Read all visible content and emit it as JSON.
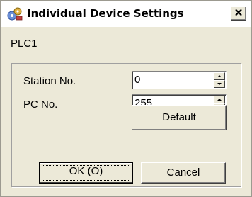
{
  "window": {
    "title": "Individual Device Settings",
    "close_glyph": "✕",
    "icon": "device-settings-icon"
  },
  "device": "PLC1",
  "fields": {
    "station_no": {
      "label": "Station No.",
      "value": "0"
    },
    "pc_no": {
      "label": "PC No.",
      "value": "255"
    }
  },
  "buttons": {
    "default": "Default",
    "ok": "OK (O)",
    "cancel": "Cancel"
  }
}
